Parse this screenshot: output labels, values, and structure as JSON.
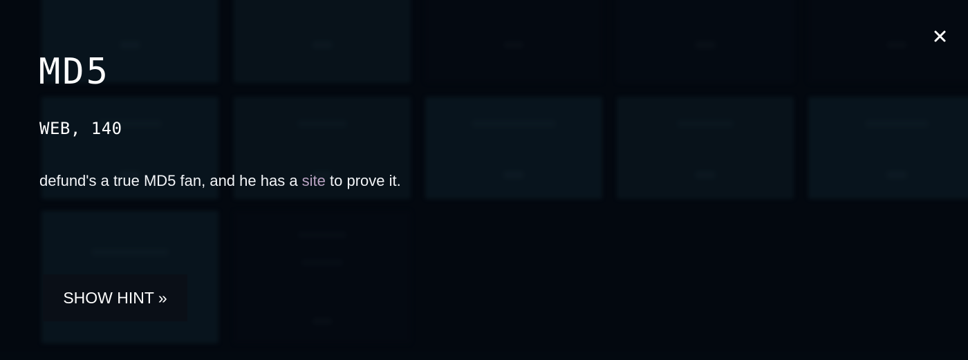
{
  "modal": {
    "title": "MD5",
    "category_points": "WEB, 140",
    "description": {
      "before_link": "defund's a true MD5 fan, and he has a ",
      "link_text": "site",
      "after_link": " to prove it."
    },
    "hint_button_label": "SHOW HINT »",
    "close_icon": "close-icon"
  },
  "colors": {
    "background": "#040a12",
    "tile_teal": "#0c1d27",
    "tile_dark": "#050b14",
    "text": "#ffffff",
    "link": "#b9a3c2",
    "hint_button_bg": "#0a0f17"
  }
}
